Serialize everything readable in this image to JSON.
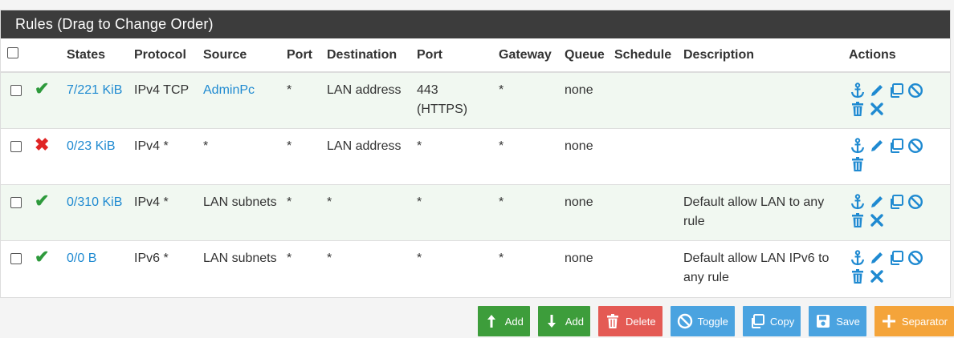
{
  "panel": {
    "title": "Rules (Drag to Change Order)"
  },
  "columns": [
    "States",
    "Protocol",
    "Source",
    "Port",
    "Destination",
    "Port",
    "Gateway",
    "Queue",
    "Schedule",
    "Description",
    "Actions"
  ],
  "rows": [
    {
      "status": "pass",
      "states": "7/221 KiB",
      "protocol": "IPv4 TCP",
      "source": "AdminPc",
      "source_port": "*",
      "destination": "LAN address",
      "dest_port": "443 (HTTPS)",
      "gateway": "*",
      "queue": "none",
      "schedule": "",
      "description": "",
      "actions": [
        "anchor-icon",
        "pencil-icon",
        "copy-icon",
        "ban-icon",
        "trash-icon",
        "times-icon"
      ]
    },
    {
      "status": "block",
      "states": "0/23 KiB",
      "protocol": "IPv4 *",
      "source": "*",
      "source_port": "*",
      "destination": "LAN address",
      "dest_port": "*",
      "gateway": "*",
      "queue": "none",
      "schedule": "",
      "description": "",
      "actions": [
        "anchor-icon",
        "pencil-icon",
        "copy-icon",
        "ban-icon",
        "trash-icon"
      ]
    },
    {
      "status": "pass",
      "states": "0/310 KiB",
      "protocol": "IPv4 *",
      "source": "LAN subnets",
      "source_port": "*",
      "destination": "*",
      "dest_port": "*",
      "gateway": "*",
      "queue": "none",
      "schedule": "",
      "description": "Default allow LAN to any rule",
      "actions": [
        "anchor-icon",
        "pencil-icon",
        "copy-icon",
        "ban-icon",
        "trash-icon",
        "times-icon"
      ]
    },
    {
      "status": "pass",
      "states": "0/0 B",
      "protocol": "IPv6 *",
      "source": "LAN subnets",
      "source_port": "*",
      "destination": "*",
      "dest_port": "*",
      "gateway": "*",
      "queue": "none",
      "schedule": "",
      "description": "Default allow LAN IPv6 to any rule",
      "actions": [
        "anchor-icon",
        "pencil-icon",
        "copy-icon",
        "ban-icon",
        "trash-icon",
        "times-icon"
      ]
    }
  ],
  "buttons": {
    "add_top": "Add",
    "add_bottom": "Add",
    "delete": "Delete",
    "toggle": "Toggle",
    "copy": "Copy",
    "save": "Save",
    "separator": "Separator"
  },
  "colors": {
    "pass": "#2e9a3c",
    "block": "#e02424",
    "link": "#1f8ad1",
    "header": "#3c3c3c"
  }
}
